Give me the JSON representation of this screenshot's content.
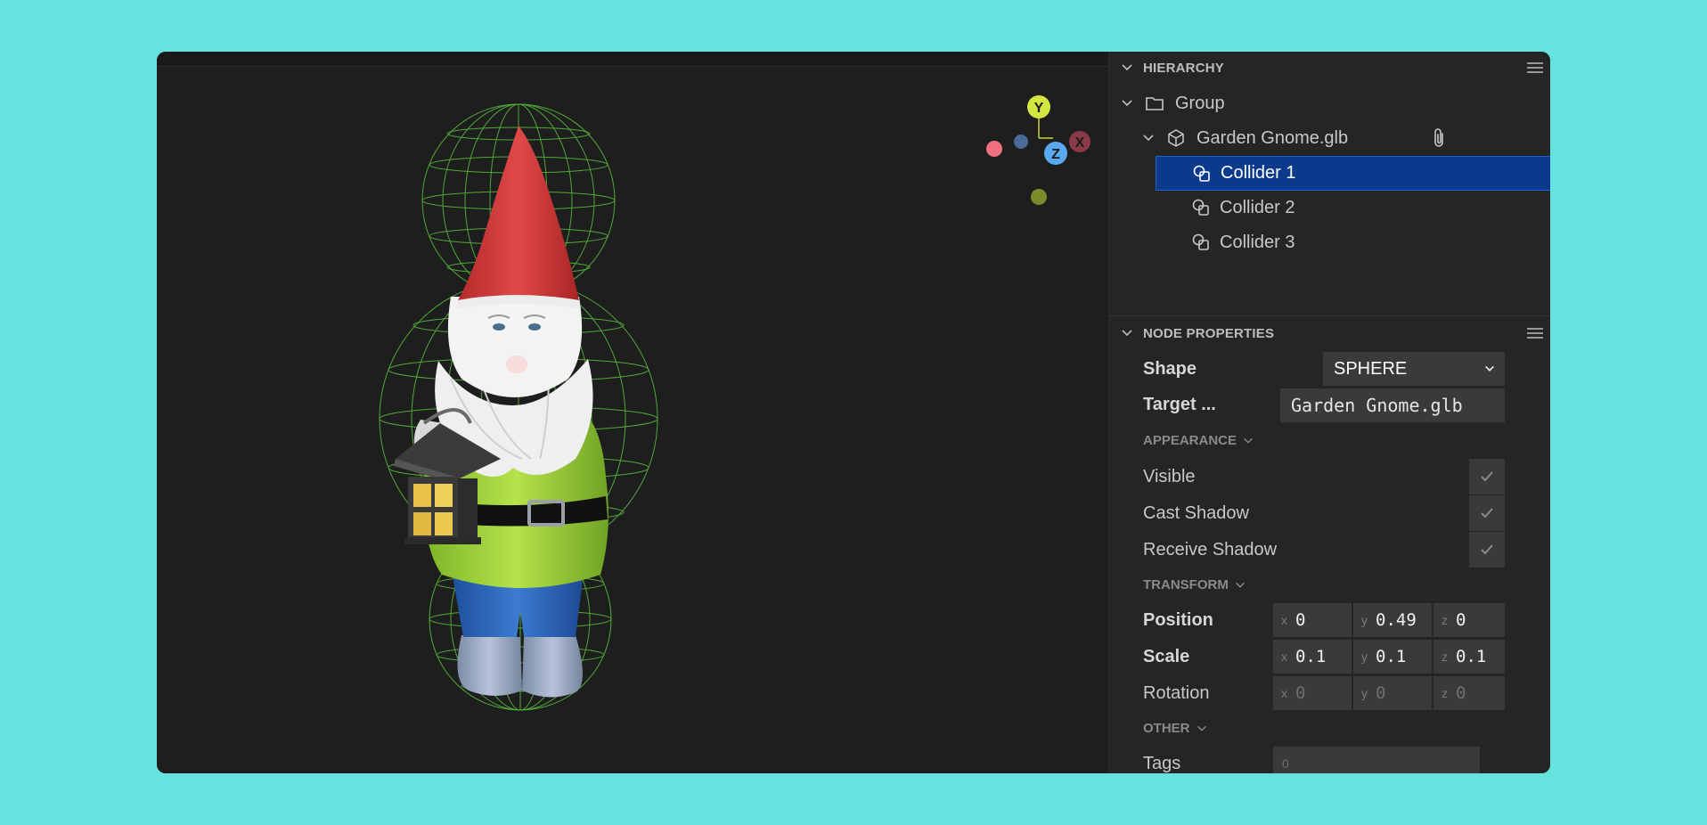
{
  "hierarchy": {
    "title": "HIERARCHY",
    "items": [
      {
        "label": "Group",
        "icon": "folder-icon"
      },
      {
        "label": "Garden Gnome.glb",
        "icon": "cube-icon"
      },
      {
        "label": "Collider 1",
        "icon": "collider-icon"
      },
      {
        "label": "Collider 2",
        "icon": "collider-icon"
      },
      {
        "label": "Collider 3",
        "icon": "collider-icon"
      }
    ]
  },
  "properties": {
    "title": "NODE PROPERTIES",
    "shape_label": "Shape",
    "shape_value": "SPHERE",
    "target_label": "Target ...",
    "target_value": "Garden Gnome.glb",
    "appearance_header": "APPEARANCE",
    "visible_label": "Visible",
    "cast_shadow_label": "Cast Shadow",
    "receive_shadow_label": "Receive Shadow",
    "transform_header": "TRANSFORM",
    "position_label": "Position",
    "position": {
      "x": "0",
      "y": "0.49",
      "z": "0"
    },
    "scale_label": "Scale",
    "scale": {
      "x": "0.1",
      "y": "0.1",
      "z": "0.1"
    },
    "rotation_label": "Rotation",
    "rotation": {
      "x": "0",
      "y": "0",
      "z": "0"
    },
    "other_header": "OTHER",
    "tags_label": "Tags",
    "tags_value": "0"
  },
  "gizmo": {
    "y_label": "Y",
    "x_label": "X",
    "z_label": "Z"
  },
  "colors": {
    "accent": "#0b3a8c",
    "collider_wire": "#58c13a",
    "background": "#67e3df"
  }
}
